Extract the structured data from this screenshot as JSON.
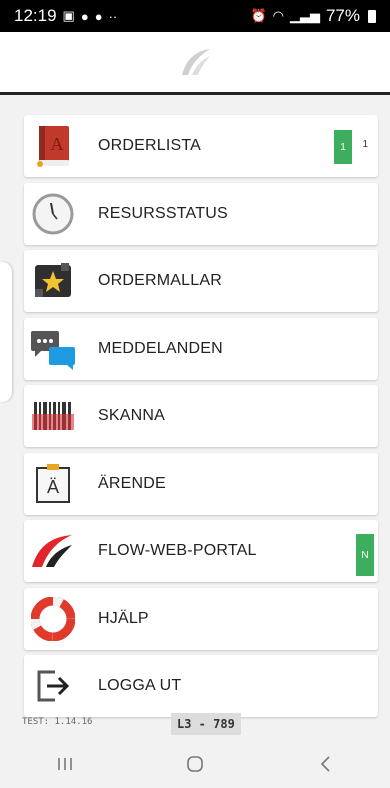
{
  "status_bar": {
    "time": "12:19",
    "battery": "77%"
  },
  "menu": [
    {
      "id": "orderlista",
      "label": "ORDERLISTA",
      "icon": "book-icon",
      "badge": "1",
      "badge_count": "1",
      "badge_color": "#3cae5e"
    },
    {
      "id": "resursstatus",
      "label": "RESURSSTATUS",
      "icon": "clock-icon"
    },
    {
      "id": "ordermallar",
      "label": "ORDERMALLAR",
      "icon": "star-template-icon"
    },
    {
      "id": "meddelanden",
      "label": "MEDDELANDEN",
      "icon": "chat-bubbles-icon"
    },
    {
      "id": "skanna",
      "label": "SKANNA",
      "icon": "barcode-icon"
    },
    {
      "id": "arende",
      "label": "ÄRENDE",
      "icon": "clipboard-icon",
      "icon_letter": "Ä"
    },
    {
      "id": "flow-web-portal",
      "label": "FLOW-WEB-PORTAL",
      "icon": "flow-logo-icon",
      "badge": "N",
      "badge_color": "#3cae5e"
    },
    {
      "id": "hjalp",
      "label": "HJÄLP",
      "icon": "lifebuoy-icon"
    },
    {
      "id": "logga-ut",
      "label": "LOGGA UT",
      "icon": "logout-icon"
    }
  ],
  "footer": {
    "version": "TEST: 1.14.16",
    "device": "L3 - 789"
  },
  "colors": {
    "status_bar_bg": "#000000",
    "badge_green": "#3cae5e",
    "header_border": "#222222"
  }
}
